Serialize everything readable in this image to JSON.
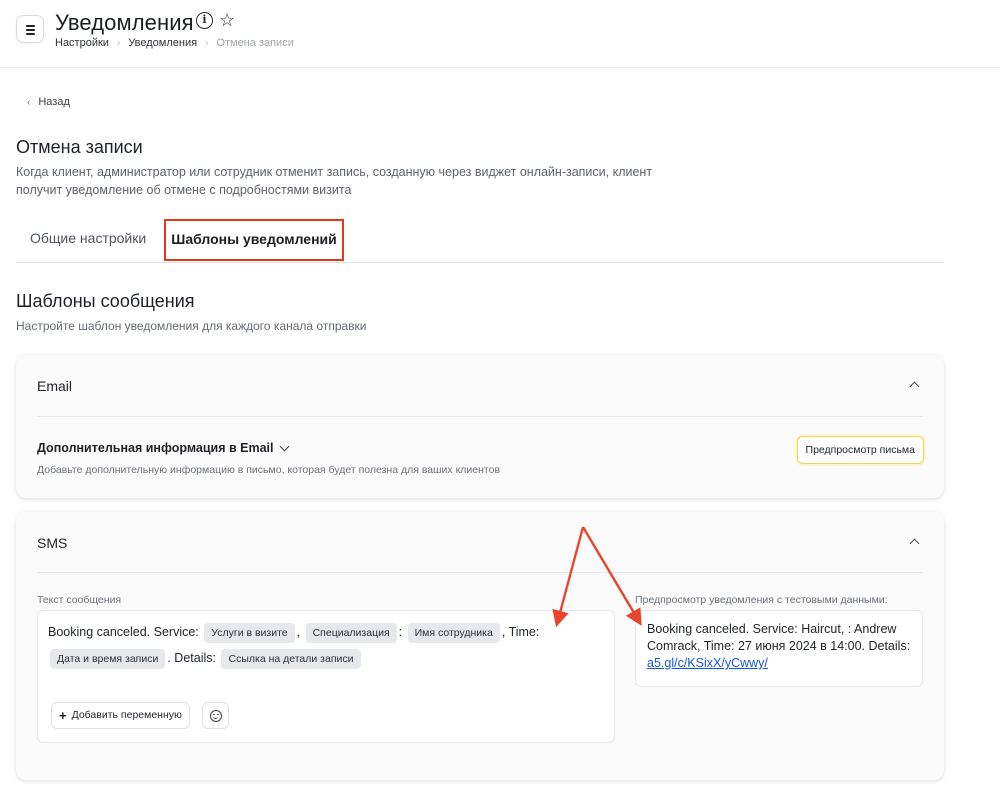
{
  "header": {
    "title": "Уведомления",
    "breadcrumbs": [
      "Настройки",
      "Уведомления",
      "Отмена записи"
    ],
    "icons": [
      "menu-icon",
      "info-icon",
      "star-icon"
    ]
  },
  "back_label": "Назад",
  "section": {
    "title": "Отмена записи",
    "description": "Когда клиент, администратор или сотрудник отменит запись, созданную через виджет онлайн-записи, клиент получит уведомление об отмене с подробностями визита"
  },
  "tabs": [
    {
      "label": "Общие настройки",
      "active": false
    },
    {
      "label": "Шаблоны уведомлений",
      "active": true
    }
  ],
  "templates": {
    "title": "Шаблоны сообщения",
    "description": "Настройте шаблон уведомления для каждого канала отправки"
  },
  "email_card": {
    "title": "Email",
    "extra_title": "Дополнительная информация в Email",
    "extra_description": "Добавьте дополнительную информацию в письмо, которая будет полезна для ваших клиентов",
    "preview_button": "Предпросмотр письма"
  },
  "sms_card": {
    "title": "SMS",
    "message_label": "Текст сообщения",
    "message": {
      "t1": "Booking canceled. Service:",
      "chip1": "Услуги в визите",
      "t2": ",",
      "chip2": "Специализация",
      "t3": ":",
      "chip3": "Имя сотрудника",
      "t4": ", Time:",
      "chip4": "Дата и время записи",
      "t5": ". Details:",
      "chip5": "Ссылка на детали записи"
    },
    "add_variable_button": "Добавить переменную",
    "preview_label": "Предпросмотр уведомления с тестовыми данными:",
    "preview_text": "Booking canceled. Service: Haircut, : Andrew Comrack, Time: 27 июня 2024 в 14:00. Details:",
    "preview_link": "a5.gl/c/KSixX/yCwwy/"
  },
  "colors": {
    "highlight": "#e5391d",
    "annotation_arrow": "#e8452c",
    "link": "#1557d6",
    "chip_bg": "#e6e8ec",
    "preview_button_border": "#f1d35c"
  }
}
